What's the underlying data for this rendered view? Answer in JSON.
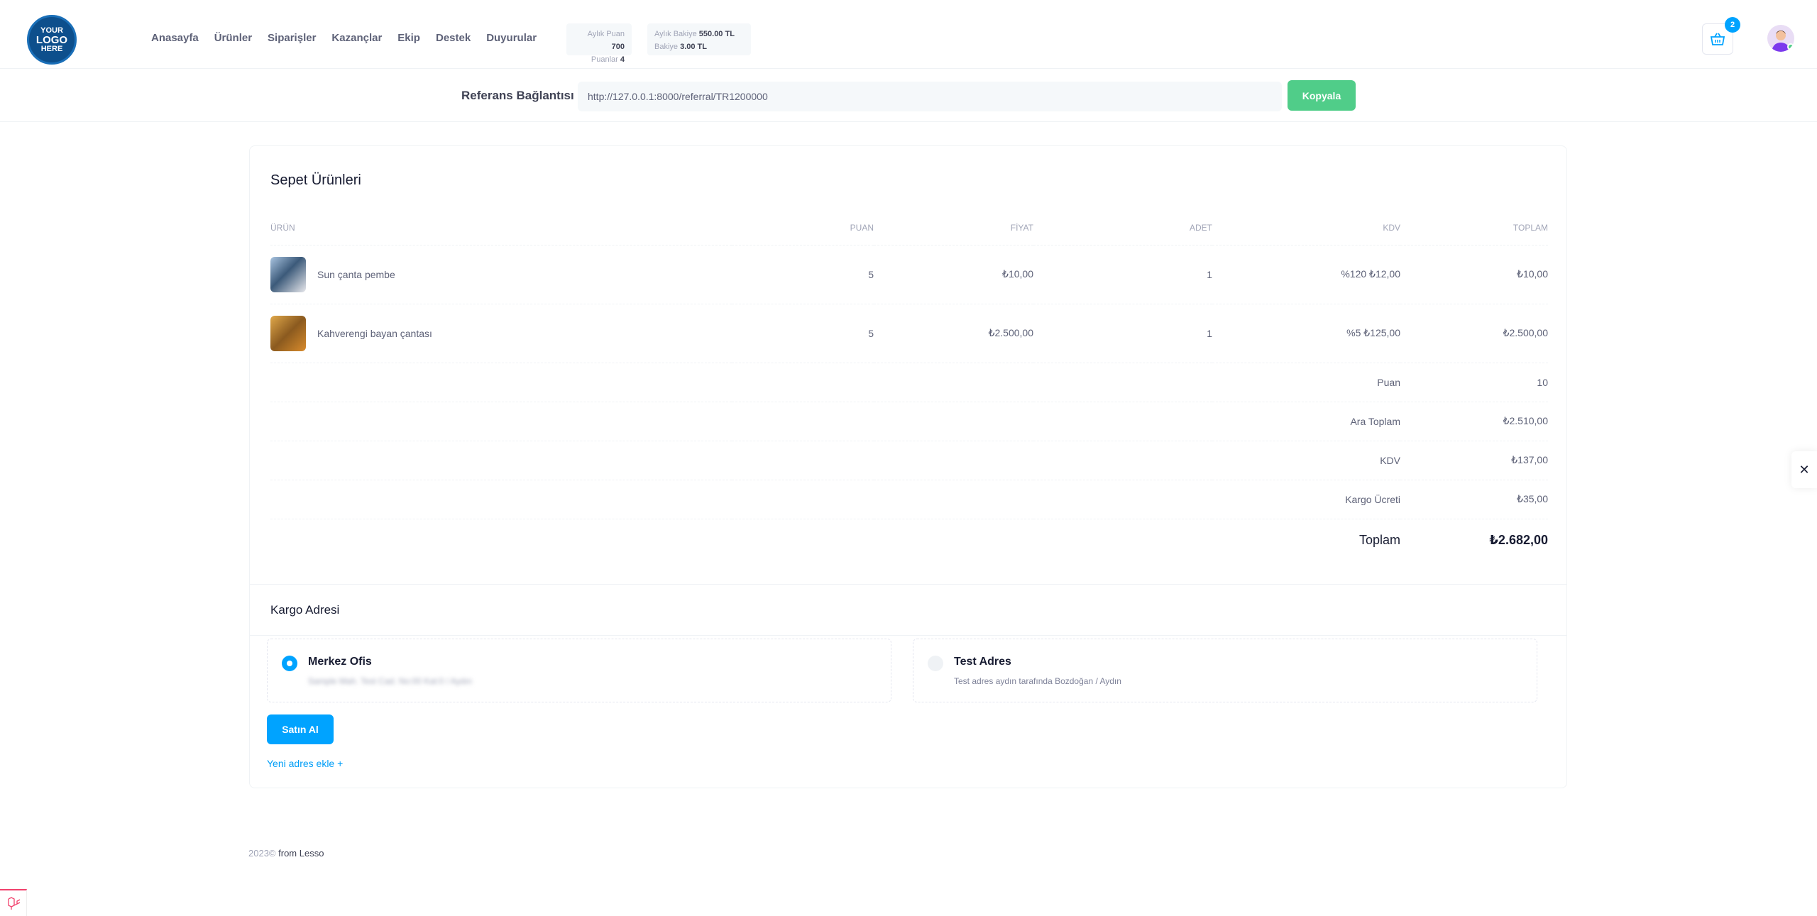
{
  "header": {
    "logo": {
      "line1": "YOUR",
      "line2": "LOGO",
      "line3": "HERE"
    },
    "nav": [
      "Anasayfa",
      "Ürünler",
      "Siparişler",
      "Kazançlar",
      "Ekip",
      "Destek",
      "Duyurular"
    ],
    "stats_points": {
      "monthly_label": "Aylık Puan",
      "monthly_value": "700",
      "points_label": "Puanlar",
      "points_value": "4"
    },
    "stats_balance": {
      "monthly_label": "Aylık Bakiye",
      "monthly_value": "550.00 TL",
      "balance_label": "Bakiye",
      "balance_value": "3.00 TL"
    },
    "cart_count": "2"
  },
  "referral": {
    "label": "Referans Bağlantısı",
    "url": "http://127.0.0.1:8000/referral/TR1200000",
    "copy_label": "Kopyala"
  },
  "cart": {
    "title": "Sepet Ürünleri",
    "columns": [
      "ÜRÜN",
      "PUAN",
      "FİYAT",
      "ADET",
      "KDV",
      "TOPLAM"
    ],
    "items": [
      {
        "name": "Sun çanta pembe",
        "points": "5",
        "price": "₺10,00",
        "qty": "1",
        "vat": "%120 ₺12,00",
        "total": "₺10,00"
      },
      {
        "name": "Kahverengi bayan çantası",
        "points": "5",
        "price": "₺2.500,00",
        "qty": "1",
        "vat": "%5 ₺125,00",
        "total": "₺2.500,00"
      }
    ],
    "summary": [
      {
        "label": "Puan",
        "value": "10"
      },
      {
        "label": "Ara Toplam",
        "value": "₺2.510,00"
      },
      {
        "label": "KDV",
        "value": "₺137,00"
      },
      {
        "label": "Kargo Ücreti",
        "value": "₺35,00"
      }
    ],
    "total": {
      "label": "Toplam",
      "value": "₺2.682,00"
    }
  },
  "shipping": {
    "title": "Kargo Adresi",
    "addresses": [
      {
        "name": "Merkez Ofis",
        "detail": "Sample Mah. Test Cad. No:00 Kat:0 / Aydın",
        "selected": true
      },
      {
        "name": "Test Adres",
        "detail": "Test adres aydın tarafında Bozdoğan / Aydın",
        "selected": false
      }
    ],
    "buy_label": "Satın Al",
    "new_address_label": "Yeni adres ekle +"
  },
  "footer": {
    "year": "2023©",
    "author": "from Lesso"
  },
  "colors": {
    "primary": "#00a3ff",
    "success": "#50cd89",
    "danger": "#f1416c"
  }
}
